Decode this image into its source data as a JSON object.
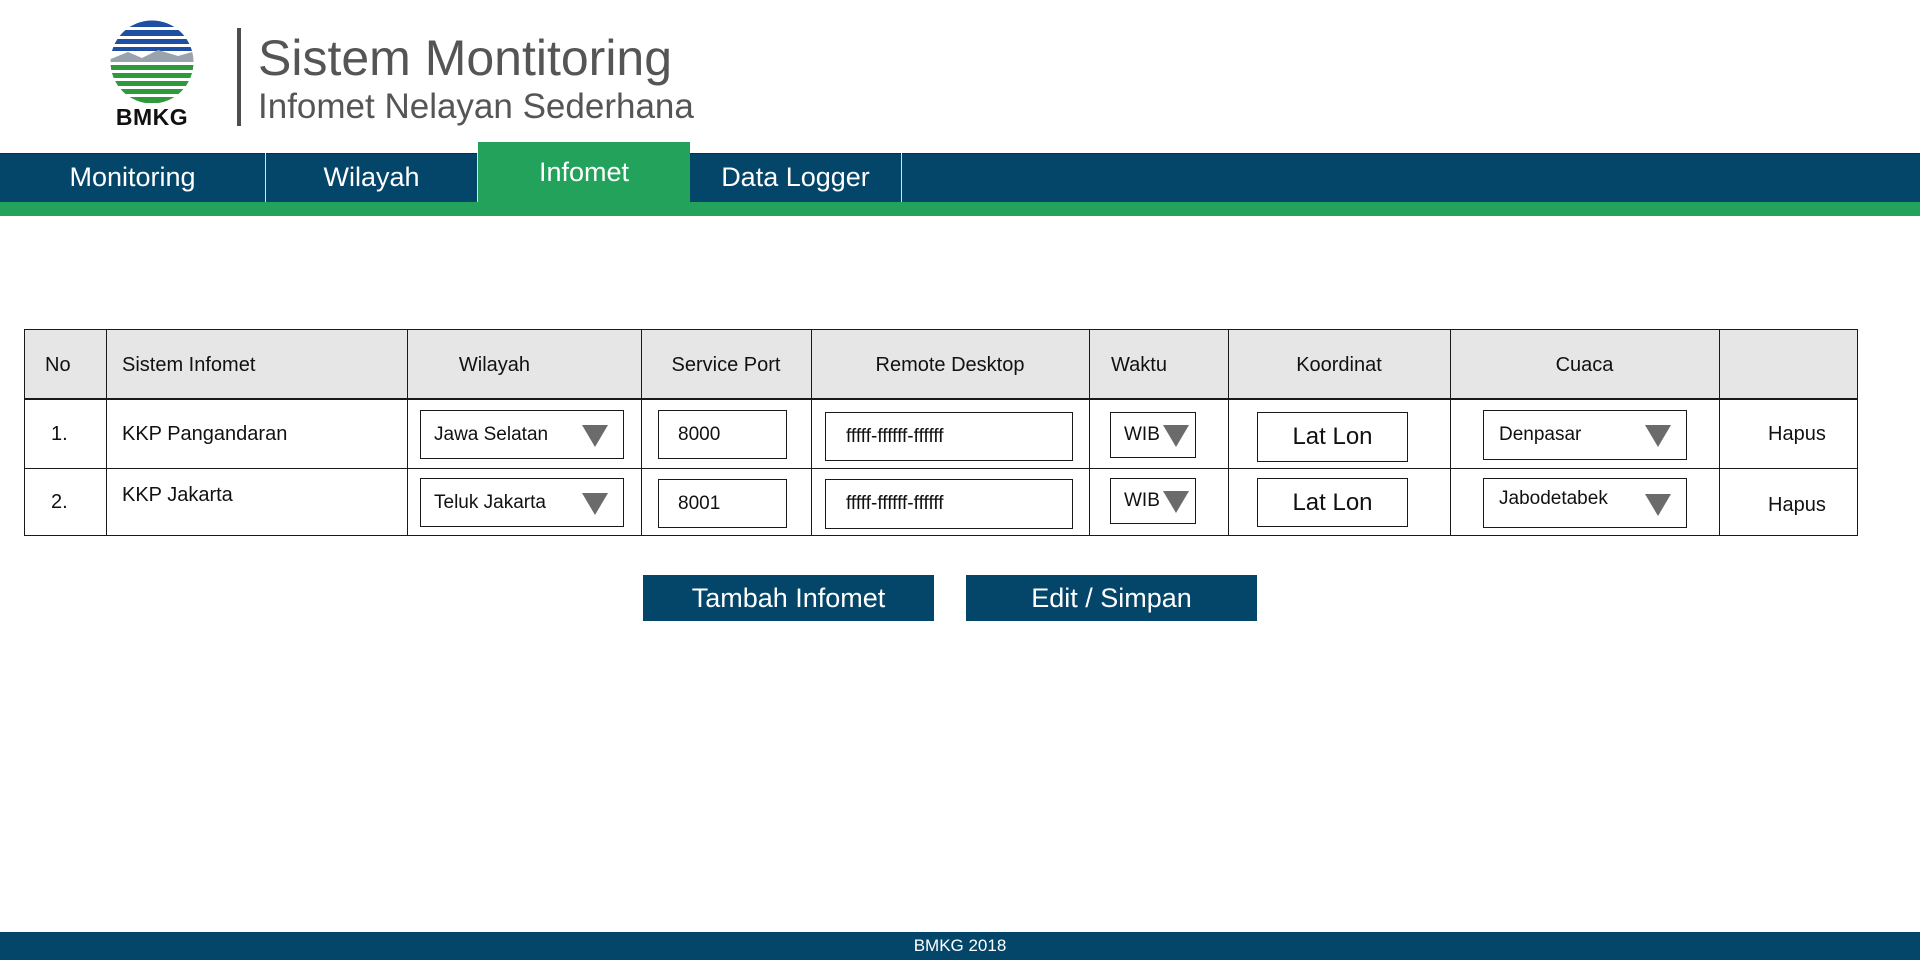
{
  "header": {
    "logo_text": "BMKG",
    "title": "Sistem Montitoring",
    "subtitle": "Infomet Nelayan Sederhana"
  },
  "nav": {
    "items": [
      {
        "label": "Monitoring"
      },
      {
        "label": "Wilayah"
      },
      {
        "label": "Infomet",
        "active": true
      },
      {
        "label": "Data Logger"
      }
    ]
  },
  "table": {
    "columns": [
      "No",
      "Sistem Infomet",
      "Wilayah",
      "Service Port",
      "Remote Desktop",
      "Waktu",
      "Koordinat",
      "Cuaca",
      ""
    ],
    "rows": [
      {
        "no": "1.",
        "sistem": "KKP Pangandaran",
        "wilayah": "Jawa Selatan",
        "port": "8000",
        "remote": "fffff-ffffff-ffffff",
        "waktu": "WIB",
        "koordinat": "Lat Lon",
        "cuaca": "Denpasar",
        "action": "Hapus"
      },
      {
        "no": "2.",
        "sistem": "KKP Jakarta",
        "wilayah": "Teluk Jakarta",
        "port": "8001",
        "remote": "fffff-ffffff-ffffff",
        "waktu": "WIB",
        "koordinat": "Lat Lon",
        "cuaca": "Jabodetabek",
        "action": "Hapus"
      }
    ]
  },
  "buttons": {
    "add": "Tambah Infomet",
    "save": "Edit / Simpan"
  },
  "footer": {
    "text": "BMKG 2018"
  },
  "colors": {
    "primary": "#03466a",
    "accent": "#22a25a",
    "header_text": "#555555",
    "table_header_bg": "#e6e6e6"
  }
}
